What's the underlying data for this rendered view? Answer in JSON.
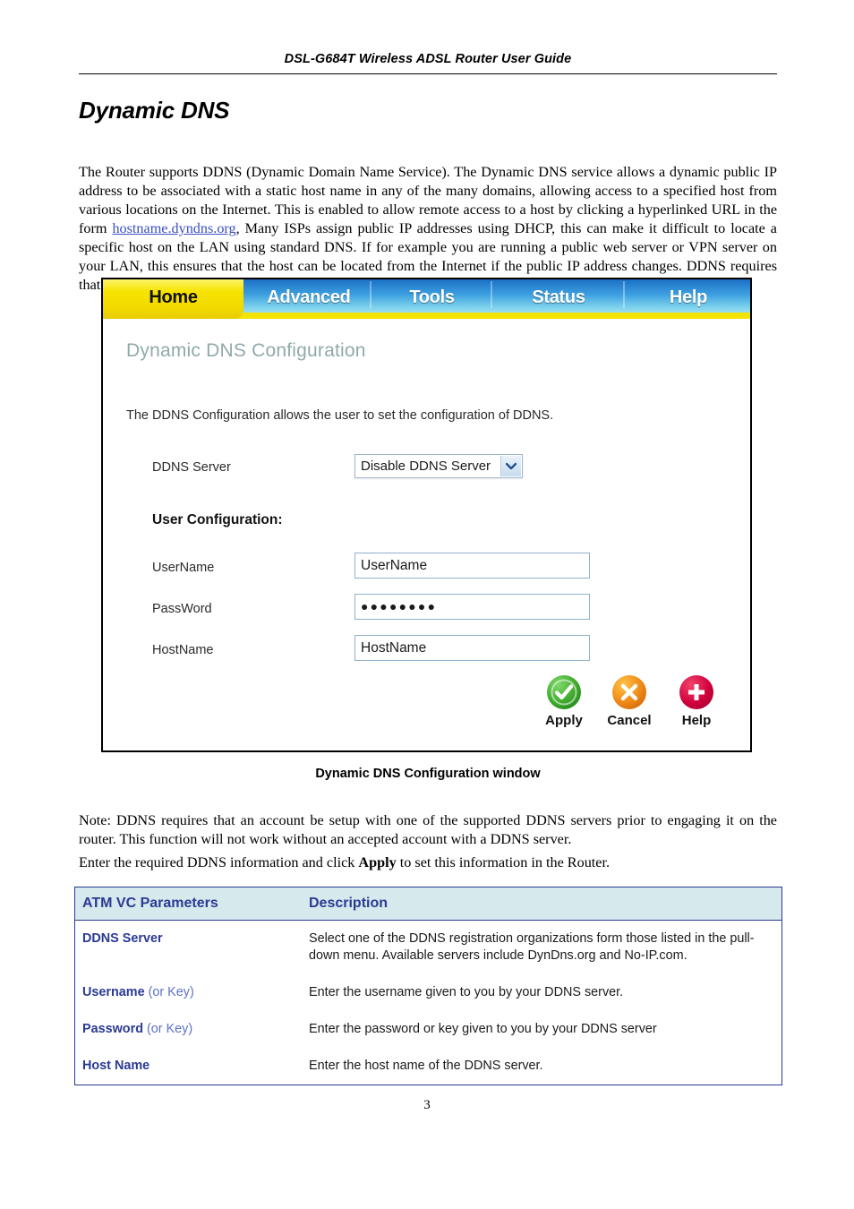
{
  "document": {
    "running_header": "DSL-G684T Wireless ADSL Router User Guide",
    "title": "Dynamic DNS",
    "page_number": "3",
    "intro_before_link": "The Router supports DDNS (Dynamic Domain Name Service). The Dynamic DNS service allows a dynamic public IP address to be associated with a static host name in any of the many domains, allowing access to a specified host from various locations on the Internet. This is enabled to allow remote access to a host by clicking a hyperlinked URL in the form ",
    "intro_link": "hostname.dyndns.org",
    "intro_after_link": ", Many ISPs assign public IP addresses using DHCP, this can make it difficult to locate a specific host on the LAN using standard DNS. If for example you are running a public web server or VPN server on your LAN, this ensures that the host can be located from the Internet if the public IP address changes. DDNS requires that an account be setup with one of the supported DDNS providers.",
    "figure_caption": "Dynamic DNS Configuration window",
    "note": "Note: DDNS requires that an account be setup with one of the supported DDNS servers prior to engaging it on the router. This function will not work without an accepted account with a DDNS server.",
    "enter_line_before": "Enter the required DDNS information and click ",
    "enter_line_bold": "Apply",
    "enter_line_after": " to set this information in the Router."
  },
  "screenshot": {
    "tabs": [
      {
        "label": "Home",
        "active": true
      },
      {
        "label": "Advanced",
        "active": false
      },
      {
        "label": "Tools",
        "active": false
      },
      {
        "label": "Status",
        "active": false
      },
      {
        "label": "Help",
        "active": false
      }
    ],
    "panel": {
      "heading": "Dynamic DNS Configuration",
      "description": "The DDNS Configuration allows the user to set the configuration of DDNS.",
      "ddns_server_label": "DDNS Server",
      "ddns_server_value": "Disable DDNS Server",
      "section_label": "User Configuration:",
      "fields": [
        {
          "label": "UserName",
          "value": "UserName",
          "type": "text"
        },
        {
          "label": "PassWord",
          "value": "●●●●●●●●",
          "type": "password"
        },
        {
          "label": "HostName",
          "value": "HostName",
          "type": "text"
        }
      ],
      "actions": [
        {
          "label": "Apply",
          "icon": "check-circle-icon",
          "color": "#3faa2c"
        },
        {
          "label": "Cancel",
          "icon": "x-circle-icon",
          "color": "#f08a16"
        },
        {
          "label": "Help",
          "icon": "plus-circle-icon",
          "color": "#d1003c"
        }
      ]
    }
  },
  "param_table": {
    "headers": [
      "ATM VC Parameters",
      "Description"
    ],
    "header_bg": "#d6e9ec",
    "accent": "#2b3a94",
    "rows": [
      {
        "name": "DDNS Server",
        "name_sub": "",
        "description": "Select one of the DDNS registration organizations form those listed in the pull-down menu. Available servers include DynDns.org and No-IP.com."
      },
      {
        "name": "Username",
        "name_sub": " (or Key)",
        "description": "Enter the username given to you by your DDNS server."
      },
      {
        "name": "Password",
        "name_sub": " (or Key)",
        "description": "Enter the password or key given to you by your DDNS server"
      },
      {
        "name": "Host Name",
        "name_sub": "",
        "description": "Enter the host name of the DDNS server."
      }
    ]
  }
}
